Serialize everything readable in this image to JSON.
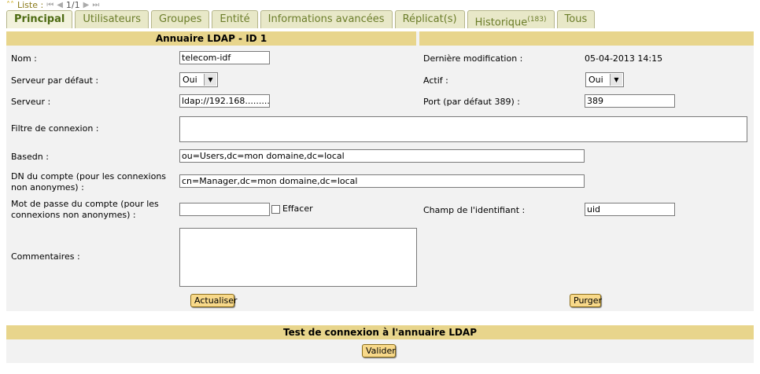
{
  "nav": {
    "liste_label": "Liste :",
    "pager": "1/1"
  },
  "tabs": [
    {
      "label": "Principal",
      "active": true
    },
    {
      "label": "Utilisateurs"
    },
    {
      "label": "Groupes"
    },
    {
      "label": "Entité"
    },
    {
      "label": "Informations avancées"
    },
    {
      "label": "Réplicat(s)"
    },
    {
      "label": "Historique",
      "count": "(183)"
    },
    {
      "label": "Tous"
    }
  ],
  "form": {
    "header_title": "Annuaire LDAP - ID 1",
    "nom_label": "Nom :",
    "nom_value": "telecom-idf",
    "derniere_mod_label": "Dernière modification :",
    "derniere_mod_value": "05-04-2013 14:15",
    "serveur_defaut_label": "Serveur par défaut :",
    "serveur_defaut_value": "Oui",
    "actif_label": "Actif :",
    "actif_value": "Oui",
    "serveur_label": "Serveur :",
    "serveur_value": "ldap://192.168.........",
    "port_label": "Port (par défaut 389) :",
    "port_value": "389",
    "filtre_label": "Filtre de connexion :",
    "filtre_value": "",
    "basedn_label": "Basedn :",
    "basedn_value": "ou=Users,dc=mon domaine,dc=local",
    "dn_compte_label": "DN du compte (pour les connexions non anonymes) :",
    "dn_compte_value": "cn=Manager,dc=mon domaine,dc=local",
    "mdp_label": "Mot de passe du compte (pour les connexions non anonymes) :",
    "mdp_value": "",
    "effacer_label": "Effacer",
    "champ_id_label": "Champ de l'identifiant :",
    "champ_id_value": "uid",
    "commentaires_label": "Commentaires :",
    "commentaires_value": "",
    "actualiser_label": "Actualiser",
    "purger_label": "Purger"
  },
  "test": {
    "header_title": "Test de connexion à l'annuaire LDAP",
    "valider_label": "Valider"
  },
  "colors": {
    "header_bg": "#e8d58c",
    "panel_bg": "#f2f2f2",
    "button_bg": "#f8d98a",
    "tab_text": "#6b7d2a"
  }
}
